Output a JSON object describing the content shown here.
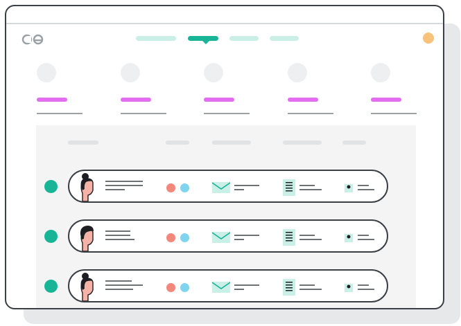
{
  "app": {
    "logo_icon": "link-logo-icon",
    "profile_icon": "user-avatar-icon"
  },
  "colors": {
    "accent": "#17b596",
    "accent_light": "#c9efe7",
    "highlight": "#e36cf0",
    "avatar": "#f7c27a",
    "dot_red": "#f3877b",
    "dot_blue": "#7fd4ee",
    "stroke": "#3a3f45"
  },
  "nav": {
    "tabs": [
      {
        "id": "tab-1",
        "active": false
      },
      {
        "id": "tab-2",
        "active": true
      },
      {
        "id": "tab-3",
        "active": false
      },
      {
        "id": "tab-4",
        "active": false
      }
    ]
  },
  "stats": [
    {
      "id": "stat-1",
      "icon": "placeholder-circle-icon"
    },
    {
      "id": "stat-2",
      "icon": "placeholder-circle-icon"
    },
    {
      "id": "stat-3",
      "icon": "placeholder-circle-icon"
    },
    {
      "id": "stat-4",
      "icon": "placeholder-circle-icon"
    },
    {
      "id": "stat-5",
      "icon": "placeholder-circle-icon"
    }
  ],
  "table": {
    "columns": [
      "col-1",
      "col-2",
      "col-3",
      "col-4",
      "col-5"
    ],
    "rows": [
      {
        "avatar": "woman-bun-avatar-icon",
        "status": "active",
        "icons": [
          "email-icon",
          "document-icon",
          "tag-icon"
        ]
      },
      {
        "avatar": "man-avatar-icon",
        "status": "active",
        "icons": [
          "email-icon",
          "document-icon",
          "tag-icon"
        ]
      },
      {
        "avatar": "woman-bun-avatar-icon",
        "status": "active",
        "icons": [
          "email-icon",
          "document-icon",
          "tag-icon"
        ]
      }
    ]
  }
}
